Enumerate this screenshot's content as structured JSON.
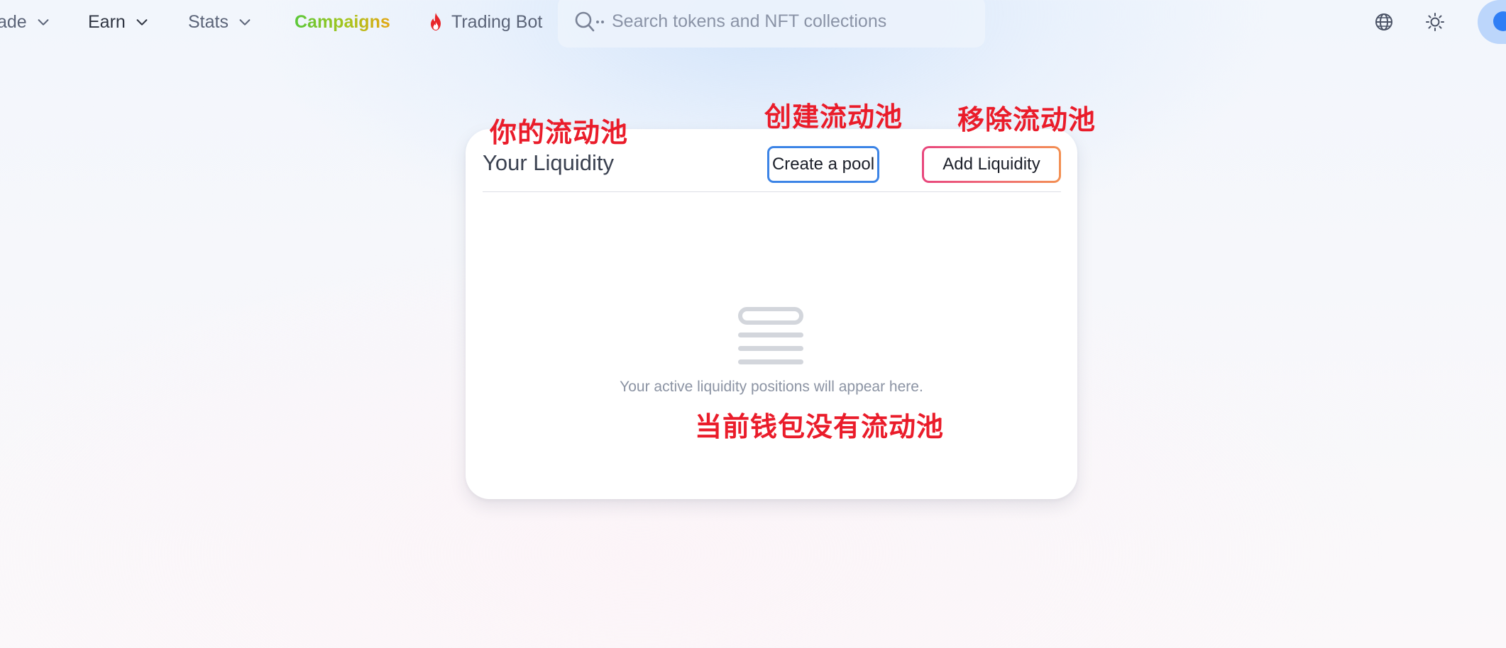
{
  "nav": {
    "items": [
      {
        "label": "ade",
        "has_chevron": true
      },
      {
        "label": "Earn",
        "has_chevron": true
      },
      {
        "label": "Stats",
        "has_chevron": true
      },
      {
        "label": "Campaigns",
        "has_chevron": false
      },
      {
        "label": "Trading Bot",
        "has_chevron": false,
        "icon": "fire-icon"
      }
    ],
    "search": {
      "placeholder": "Search tokens and NFT collections",
      "icon": "search-icon"
    },
    "right_icons": [
      "globe-icon",
      "sun-icon"
    ]
  },
  "liquidity": {
    "title": "Your Liquidity",
    "create_button": "Create a pool",
    "add_button": "Add Liquidity",
    "empty_icon": "stack-list-icon",
    "empty_message": "Your active liquidity positions will appear here."
  },
  "annotations": {
    "title_note": "你的流动池",
    "create_note": "创建流动池",
    "add_note": "移除流动池",
    "empty_note": "当前钱包没有流动池"
  },
  "colors": {
    "annotation": "#ea1c2a",
    "create_border": "#3c84e6",
    "add_border_gradient": [
      "#e8467c",
      "#f39052"
    ],
    "campaigns_gradient": [
      "#5ac83a",
      "#e4a614"
    ]
  }
}
